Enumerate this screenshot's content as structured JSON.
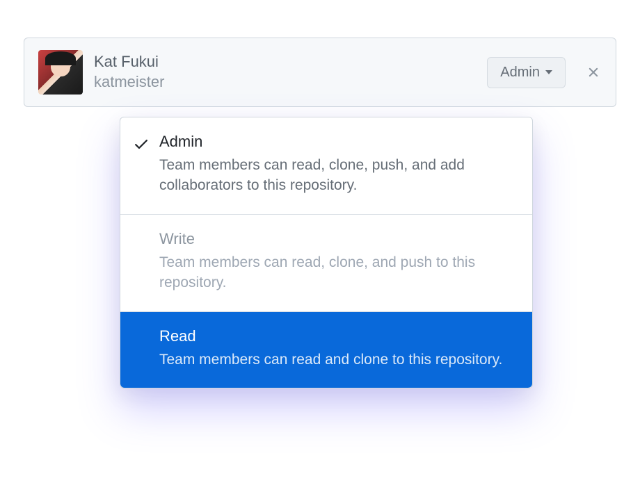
{
  "user": {
    "display_name": "Kat Fukui",
    "username": "katmeister"
  },
  "role_button": {
    "label": "Admin"
  },
  "dropdown": {
    "options": [
      {
        "title": "Admin",
        "description": "Team members can read, clone, push, and add collaborators to this repository.",
        "selected": true,
        "highlighted": false
      },
      {
        "title": "Write",
        "description": "Team members can read, clone, and push to this repository.",
        "selected": false,
        "highlighted": false
      },
      {
        "title": "Read",
        "description": "Team members can read and clone to this repository.",
        "selected": false,
        "highlighted": true
      }
    ]
  }
}
